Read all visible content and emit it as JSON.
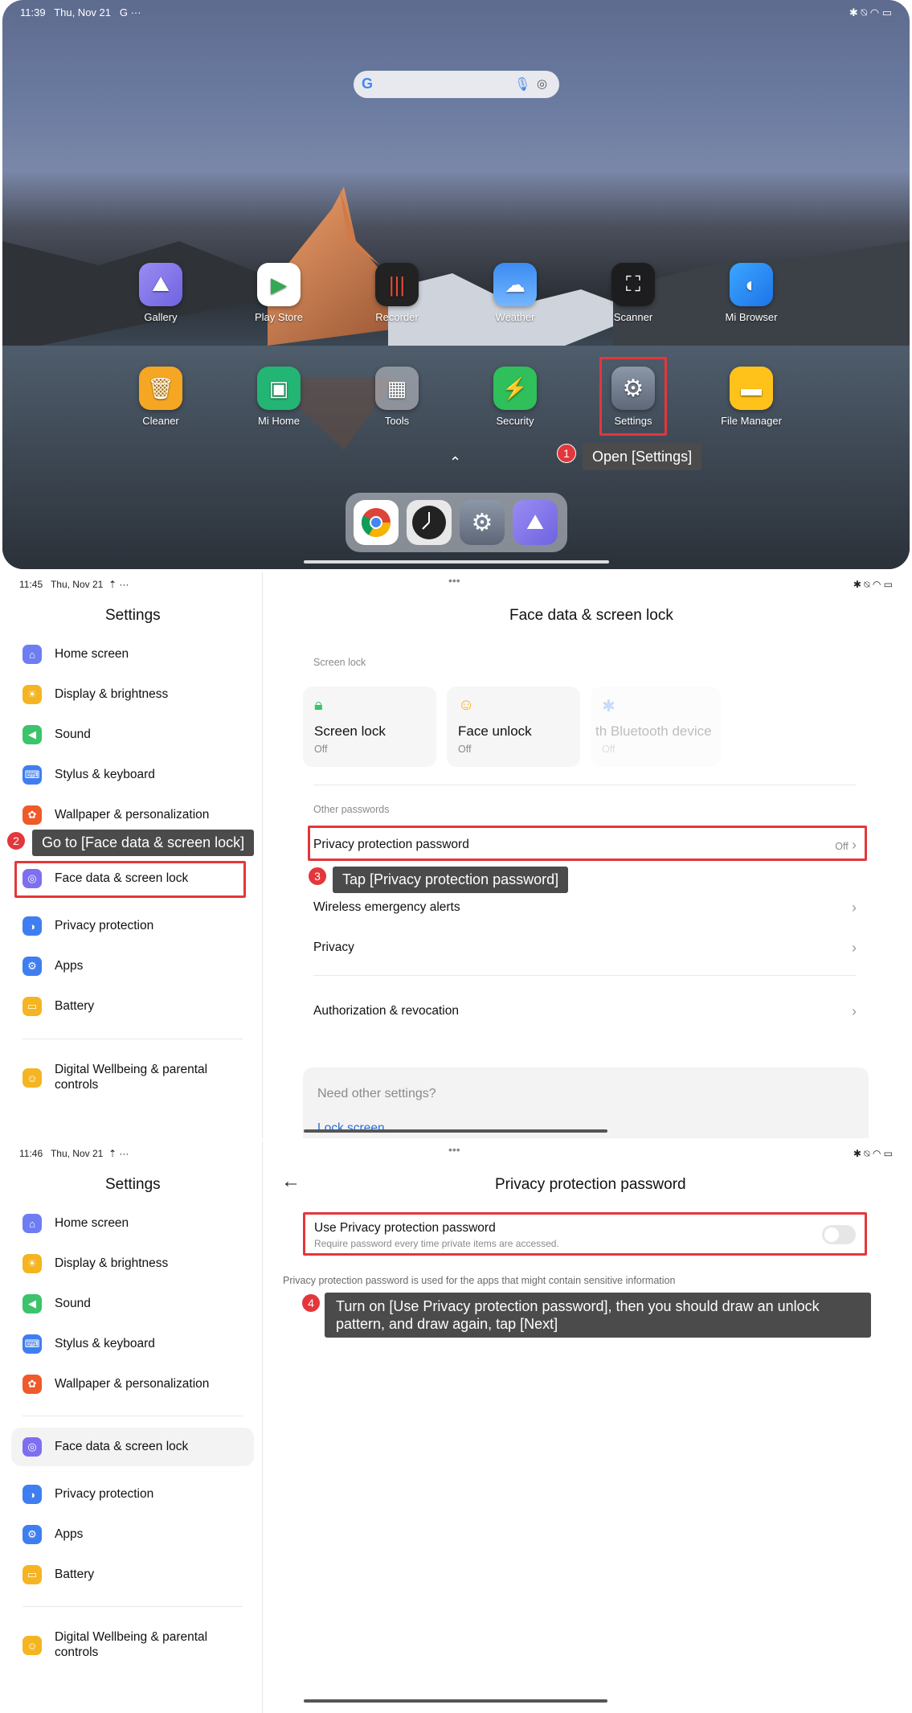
{
  "home": {
    "status_time": "11:39",
    "status_date": "Thu, Nov 21",
    "status_extra": "G ···",
    "apps_row1": [
      "Gallery",
      "Play Store",
      "Recorder",
      "Weather",
      "Scanner",
      "Mi Browser"
    ],
    "apps_row2": [
      "Cleaner",
      "Mi Home",
      "Tools",
      "Security",
      "Settings",
      "File Manager"
    ],
    "step1_num": "1",
    "step1_text": "Open [Settings]"
  },
  "settings1": {
    "status_time": "11:45",
    "status_date": "Thu, Nov 21",
    "sidebar_title": "Settings",
    "sidebar_items": [
      "Home screen",
      "Display & brightness",
      "Sound",
      "Stylus & keyboard",
      "Wallpaper & personalization",
      "Face data & screen lock",
      "Privacy protection",
      "Apps",
      "Battery"
    ],
    "sidebar_wellbeing": "Digital Wellbeing & parental controls",
    "page_title": "Face data & screen lock",
    "section_screen_lock": "Screen lock",
    "cards": [
      {
        "title": "Screen lock",
        "sub": "Off"
      },
      {
        "title": "Face unlock",
        "sub": "Off"
      },
      {
        "title": "th Bluetooth device",
        "sub": "Off"
      }
    ],
    "section_other": "Other passwords",
    "row_privacy_password": "Privacy protection password",
    "row_privacy_password_value": "Off",
    "row_wireless": "Wireless emergency alerts",
    "row_privacy": "Privacy",
    "row_auth": "Authorization & revocation",
    "need_other": "Need other settings?",
    "lock_screen_link": "Lock screen",
    "step2_num": "2",
    "step2_text": "Go to [Face data & screen lock]",
    "step3_num": "3",
    "step3_text": "Tap [Privacy protection password]"
  },
  "settings2": {
    "status_time": "11:46",
    "status_date": "Thu, Nov 21",
    "sidebar_title": "Settings",
    "page_title": "Privacy protection password",
    "use_title": "Use Privacy protection password",
    "use_sub": "Require password every time private items are accessed.",
    "toggle_on": false,
    "info_text": "Privacy protection password is used for the apps that might contain sensitive information",
    "step4_num": "4",
    "step4_text": "Turn on [Use Privacy protection password], then you should draw an unlock pattern, and draw again, tap [Next]"
  }
}
